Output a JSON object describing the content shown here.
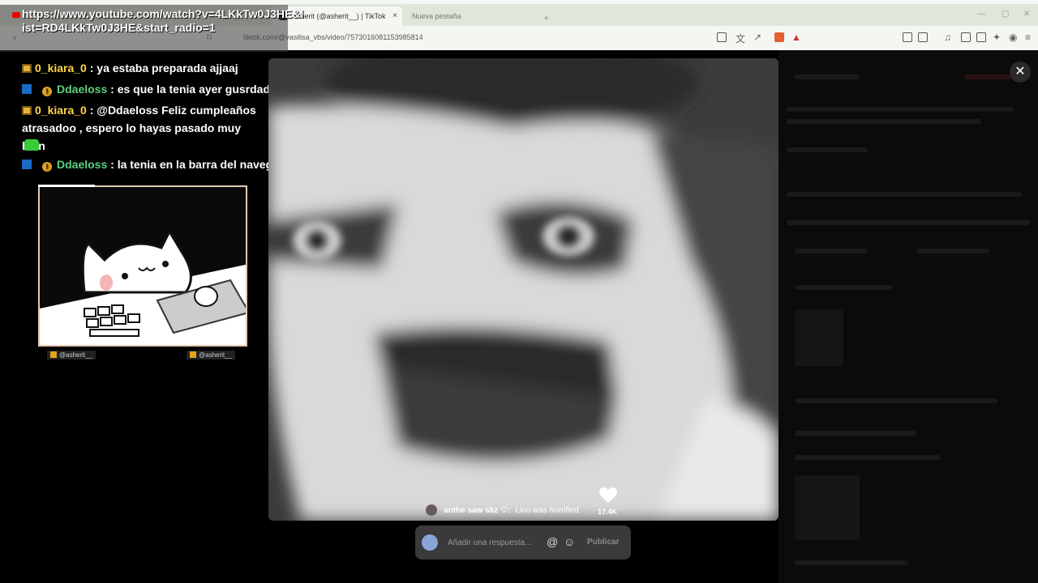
{
  "browser": {
    "tabs": [
      {
        "label": "Asherit (@asherit__) | TikTok",
        "active": true
      },
      {
        "label": "Nueva pestaña",
        "active": false
      }
    ],
    "new_tab_symbol": "+",
    "close_symbol": "×",
    "address": "tiktok.com/@vasilisa_vbs/video/7573016081153985814"
  },
  "stream_overlay": {
    "youtube_url": "https://www.youtube.com/watch?v=4LKkTw0J3HE&list=RD4LKkTw0J3HE&start_radio=1",
    "chat": [
      {
        "user": "0_kiara_0",
        "separator": " : ",
        "text": "ya estaba preparada ajjaaj",
        "user_color": "#ffd54a",
        "badges": [
          "crown"
        ]
      },
      {
        "user": "Ddaeloss",
        "separator": " : ",
        "text": "es que la tenia ayer gusrdada",
        "user_color": "#5ad17f",
        "badges": [
          "prime",
          "tier"
        ]
      },
      {
        "user": "0_kiara_0",
        "separator": " : ",
        "text": "@Ddaeloss Feliz cumpleaños atrasadoo , espero lo hayas pasado muy bien",
        "user_color": "#ffd54a",
        "badges": [
          "crown"
        ]
      },
      {
        "user": "Ddaeloss",
        "separator": " : ",
        "text": "la tenia en la barra del navegador",
        "user_color": "#5ad17f",
        "badges": [
          "prime",
          "tier"
        ]
      }
    ],
    "socials": [
      {
        "handle": "@asherit__",
        "icon": "kofi-icon"
      },
      {
        "handle": "@asherit__",
        "icon": "twitter-icon"
      }
    ]
  },
  "video": {
    "caption_author": "anthe saw skz ♡:",
    "caption_text": "Lino was horrified",
    "likes": "17.4K",
    "close_symbol": "✕"
  },
  "reply": {
    "placeholder": "Añadir una respuesta...",
    "mention_symbol": "@",
    "emoji_symbol": "☺",
    "publish_label": "Publicar"
  },
  "colors": {
    "kiara": "#ffd54a",
    "ddaeloss": "#5ad17f",
    "youtube_red": "#e00000"
  }
}
